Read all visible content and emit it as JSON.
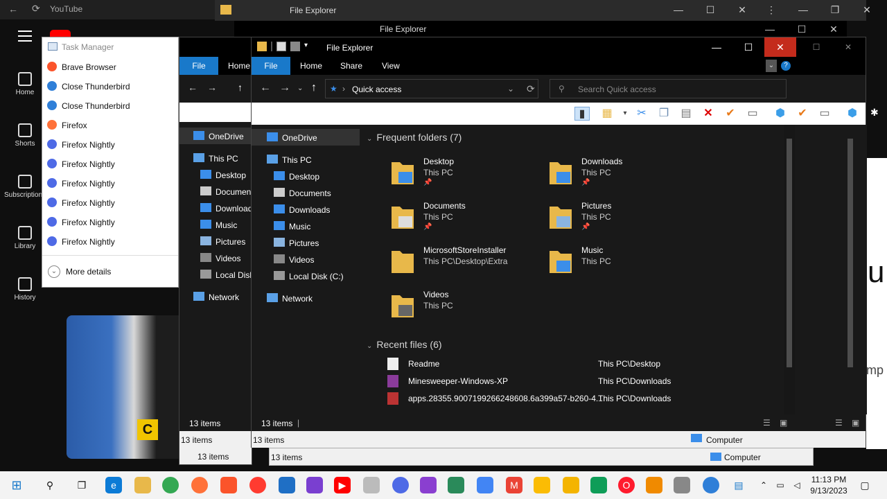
{
  "youtube": {
    "tab_title": "YouTube",
    "nav": [
      "Home",
      "Shorts",
      "Subscriptions",
      "Library",
      "History"
    ],
    "right_text_big": "u",
    "right_text_small": "mp",
    "thumb_badge": "C"
  },
  "back_explorers": {
    "title": "File Explorer",
    "status": "13 items",
    "status_computer": "Computer",
    "tab_file": "File",
    "tab_home": "Home",
    "partial_status_right": "puter"
  },
  "task_manager": {
    "title": "Task Manager",
    "items": [
      {
        "label": "Brave Browser",
        "color": "#fb542b"
      },
      {
        "label": "Close Thunderbird",
        "color": "#2f7fd8"
      },
      {
        "label": "Close Thunderbird",
        "color": "#2f7fd8"
      },
      {
        "label": "Firefox",
        "color": "#ff7139"
      },
      {
        "label": "Firefox Nightly",
        "color": "#4e6ae6"
      },
      {
        "label": "Firefox Nightly",
        "color": "#4e6ae6"
      },
      {
        "label": "Firefox Nightly",
        "color": "#4e6ae6"
      },
      {
        "label": "Firefox Nightly",
        "color": "#4e6ae6"
      },
      {
        "label": "Firefox Nightly",
        "color": "#4e6ae6"
      },
      {
        "label": "Firefox Nightly",
        "color": "#4e6ae6"
      }
    ],
    "more_details": "More details"
  },
  "explorer": {
    "title": "File Explorer",
    "window_controls": {
      "minimize": "—",
      "maximize": "☐",
      "close": "✕"
    },
    "ribbon_tabs": [
      "File",
      "Home",
      "Share",
      "View"
    ],
    "address": "Quick access",
    "search_placeholder": "Search Quick access",
    "sidebar": [
      {
        "label": "OneDrive",
        "icon": "cloud-icon",
        "selected": true
      },
      {
        "label": "This PC",
        "icon": "pc-icon"
      },
      {
        "label": "Desktop",
        "icon": "desktop-icon"
      },
      {
        "label": "Documents",
        "icon": "documents-icon"
      },
      {
        "label": "Downloads",
        "icon": "downloads-icon"
      },
      {
        "label": "Music",
        "icon": "music-icon"
      },
      {
        "label": "Pictures",
        "icon": "pictures-icon"
      },
      {
        "label": "Videos",
        "icon": "videos-icon"
      },
      {
        "label": "Local Disk (C:)",
        "icon": "disk-icon"
      },
      {
        "label": "Network",
        "icon": "network-icon"
      }
    ],
    "back_sidebar": [
      "OneDrive",
      "This PC",
      "Desktop",
      "Documen",
      "Download",
      "Music",
      "Pictures",
      "Videos",
      "Local Disk",
      "Network"
    ],
    "frequent_header": "Frequent folders (7)",
    "folders": [
      {
        "name": "Desktop",
        "location": "This PC",
        "pinned": true
      },
      {
        "name": "Downloads",
        "location": "This PC",
        "pinned": true
      },
      {
        "name": "Documents",
        "location": "This PC",
        "pinned": true
      },
      {
        "name": "Pictures",
        "location": "This PC",
        "pinned": true
      },
      {
        "name": "MicrosoftStoreInstaller",
        "location": "This PC\\Desktop\\Extra",
        "pinned": false
      },
      {
        "name": "Music",
        "location": "This PC",
        "pinned": false
      },
      {
        "name": "Videos",
        "location": "This PC",
        "pinned": false
      }
    ],
    "recent_header": "Recent files (6)",
    "recent_files": [
      {
        "name": "Readme",
        "location": "This PC\\Desktop"
      },
      {
        "name": "Minesweeper-Windows-XP",
        "location": "This PC\\Downloads"
      },
      {
        "name": "apps.28355.9007199266248608.6a399a57-b260-4...",
        "location": "This PC\\Downloads"
      }
    ],
    "status_items": "13 items",
    "status_items_2": "13 items",
    "status_computer": "Computer"
  },
  "taskbar": {
    "time": "11:13 PM",
    "date": "9/13/2023"
  }
}
